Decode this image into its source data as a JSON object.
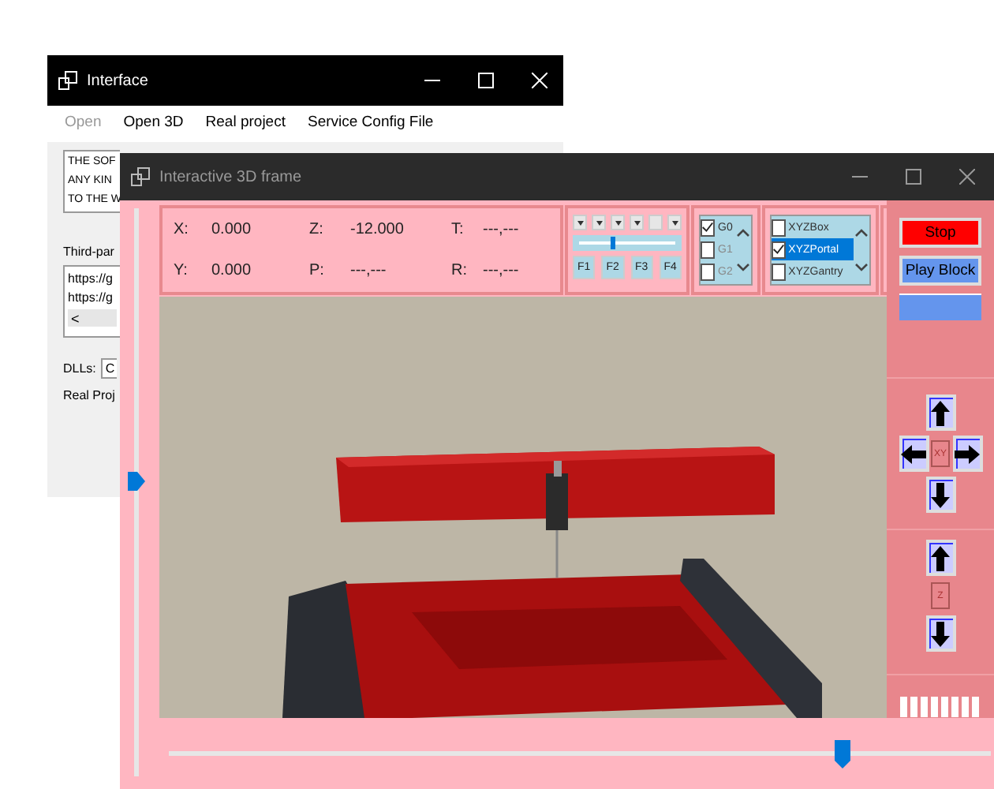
{
  "background_window": {
    "title": "Interface",
    "menu": [
      {
        "label": "Open",
        "disabled": true
      },
      {
        "label": "Open 3D",
        "disabled": false
      },
      {
        "label": "Real project",
        "disabled": false
      },
      {
        "label": "Service Config File",
        "disabled": false
      }
    ],
    "license_lines": [
      "THE SOF",
      "ANY KIN",
      "TO THE W"
    ],
    "third_party_label": "Third-par",
    "links": [
      "https://g",
      "https://g"
    ],
    "scroll_left": "<",
    "dlls_label": "DLLs:",
    "dlls_value": "C",
    "real_project_label": "Real Proj"
  },
  "window": {
    "title": "Interactive 3D frame"
  },
  "vertical_slider": {
    "level": 0.52
  },
  "coordinates": [
    {
      "label": "X:",
      "value": "0.000"
    },
    {
      "label": "Z:",
      "value": "-12.000"
    },
    {
      "label": "T:",
      "value": "---,---"
    },
    {
      "label": "Y:",
      "value": "0.000"
    },
    {
      "label": "P:",
      "value": "---,---"
    },
    {
      "label": "R:",
      "value": "---,---"
    }
  ],
  "dropdowns": [
    {
      "kind": "caret"
    },
    {
      "kind": "caret"
    },
    {
      "kind": "caret"
    },
    {
      "kind": "caret"
    },
    {
      "kind": "blank"
    },
    {
      "kind": "caret"
    }
  ],
  "speed_slider": {
    "level": 0.35
  },
  "function_keys": [
    "F1",
    "F2",
    "F3",
    "F4"
  ],
  "groups": [
    {
      "label": "G0",
      "checked": true,
      "disabled": false
    },
    {
      "label": "G1",
      "checked": false,
      "disabled": true
    },
    {
      "label": "G2",
      "checked": false,
      "disabled": true
    }
  ],
  "machines": [
    {
      "label": "XYZBox",
      "checked": false,
      "selected": false
    },
    {
      "label": "XYZPortal",
      "checked": true,
      "selected": true
    },
    {
      "label": "XYZGantry",
      "checked": false,
      "selected": false
    }
  ],
  "buttons": [
    {
      "label": "Stop",
      "kind": "stop"
    },
    {
      "label": "Play Block",
      "kind": "play"
    }
  ],
  "progress": {
    "level": 1
  },
  "jog_xy": {
    "label": "XY"
  },
  "jog_z": {
    "label": "Z"
  },
  "timeline_slider": {
    "level": 0.82
  }
}
